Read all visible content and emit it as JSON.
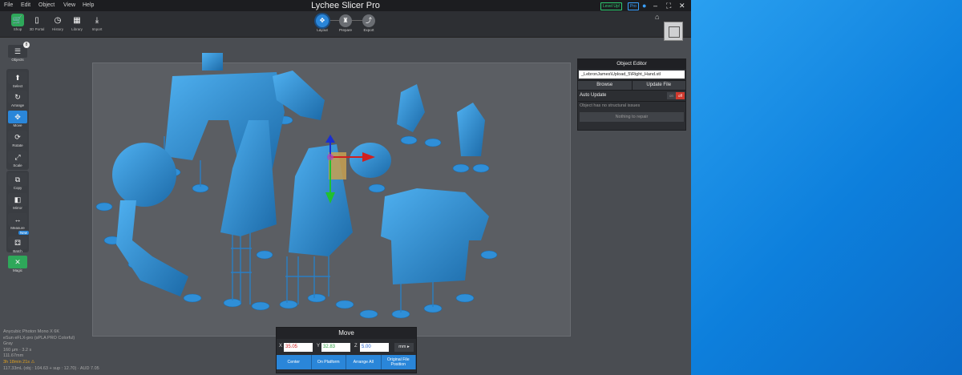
{
  "app": {
    "title": "Lychee Slicer Pro",
    "menu": [
      "File",
      "Edit",
      "Object",
      "View",
      "Help"
    ],
    "badges": [
      {
        "label": "Level Up!",
        "color": "#2ecc71"
      },
      {
        "label": "Pro",
        "color": "#3aa0ff"
      }
    ],
    "window_controls": [
      "–",
      "⛶",
      "✕"
    ]
  },
  "toolbar": {
    "left_tools": [
      {
        "label": "Shop",
        "icon": "cart-icon",
        "glyph": "🛒",
        "active": true
      },
      {
        "label": "3D Portal",
        "icon": "phone-icon",
        "glyph": "▯",
        "active": false
      },
      {
        "label": "History",
        "icon": "history-icon",
        "glyph": "◷",
        "active": false
      },
      {
        "label": "Library",
        "icon": "library-icon",
        "glyph": "▦",
        "active": false
      },
      {
        "label": "Import",
        "icon": "import-icon",
        "glyph": "⤓",
        "active": false
      }
    ],
    "workflow": [
      {
        "label": "Layout",
        "icon": "layout-icon",
        "glyph": "✥",
        "active": true
      },
      {
        "label": "Prepare",
        "icon": "prepare-icon",
        "glyph": "♜",
        "active": false
      },
      {
        "label": "Export",
        "icon": "export-icon",
        "glyph": "⤴",
        "active": false
      }
    ]
  },
  "left_panel": {
    "objects": {
      "label": "Objects",
      "count": "8",
      "icon": "list-icon"
    },
    "tools": [
      {
        "label": "Select",
        "icon": "cursor-icon",
        "glyph": "⬆",
        "state": "normal"
      },
      {
        "label": "Arrange",
        "icon": "arrange-icon",
        "glyph": "↻",
        "state": "normal"
      },
      {
        "label": "Move",
        "icon": "move-icon",
        "glyph": "✥",
        "state": "selected"
      },
      {
        "label": "Rotate",
        "icon": "rotate-icon",
        "glyph": "⟳",
        "state": "normal"
      },
      {
        "label": "Scale",
        "icon": "scale-icon",
        "glyph": "⤢",
        "state": "normal"
      },
      {
        "label": "Copy",
        "icon": "copy-icon",
        "glyph": "⧉",
        "state": "normal"
      },
      {
        "label": "Mirror",
        "icon": "mirror-icon",
        "glyph": "◧",
        "state": "normal"
      },
      {
        "label": "Measure",
        "icon": "measure-icon",
        "glyph": "↔",
        "state": "normal"
      },
      {
        "label": "Batch",
        "icon": "batch-icon",
        "glyph": "⚃",
        "state": "normal"
      },
      {
        "label": "Magic",
        "icon": "magic-icon",
        "glyph": "✕",
        "state": "green"
      }
    ],
    "new_badge": "New"
  },
  "object_editor": {
    "title": "Object Editor",
    "file": "_LebronJames\\Upload_5\\Right_Hand.stl",
    "browse": "Browse",
    "update_file": "Update File",
    "auto_update": "Auto Update",
    "toggle_on": "on",
    "toggle_off": "off",
    "message": "Object has no structural issues",
    "repair": "Nothing to repair"
  },
  "move_panel": {
    "title": "Move",
    "x_label": "X",
    "x": "35.05",
    "y_label": "Y",
    "y": "32.83",
    "z_label": "Z",
    "z": "5.00",
    "unit": "mm ▸",
    "actions": [
      "Center",
      "On Platform",
      "Arrange All",
      "Original File Position"
    ]
  },
  "stats": [
    "Anycubic Photon Mono X 6K",
    "eSun eFLX-pro (sPLA PRO Colorful)",
    "Gray",
    "160 µm · 3.2 s",
    "111.67mm",
    "3h 18min 21s ⚠",
    "117.33mL (obj : 104.63 + sup : 12.70) · AUD 7.05"
  ],
  "colors": {
    "accent": "#2a86d9",
    "green": "#2ea85a",
    "model": "#2f8fd8",
    "model_dark": "#1c6aa8",
    "desktop": "#1e8fe6"
  }
}
